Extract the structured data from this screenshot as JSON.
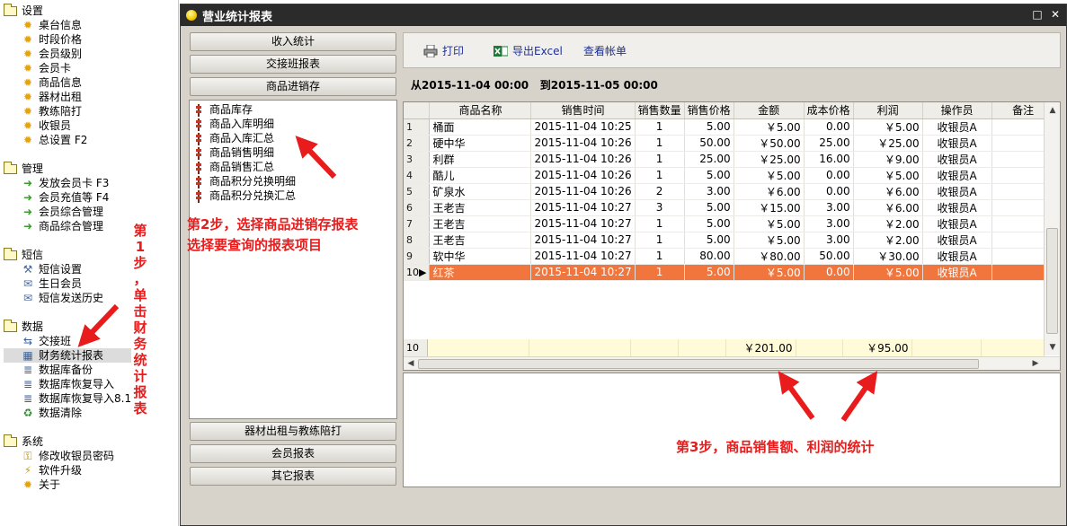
{
  "tree": {
    "groups": [
      {
        "label": "设置",
        "items": [
          "桌台信息",
          "时段价格",
          "会员级别",
          "会员卡",
          "商品信息",
          "器材出租",
          "教练陪打",
          "收银员",
          "总设置 F2"
        ]
      },
      {
        "label": "管理",
        "items": [
          "发放会员卡 F3",
          "会员充值等 F4",
          "会员综合管理",
          "商品综合管理"
        ]
      },
      {
        "label": "短信",
        "items": [
          "短信设置",
          "生日会员",
          "短信发送历史"
        ]
      },
      {
        "label": "数据",
        "items": [
          "交接班",
          "财务统计报表",
          "数据库备份",
          "数据库恢复导入",
          "数据库恢复导入8.1",
          "数据清除"
        ]
      },
      {
        "label": "系统",
        "items": [
          "修改收银员密码",
          "软件升级",
          "关于"
        ]
      }
    ]
  },
  "window": {
    "title": "营业统计报表",
    "minimize_glyph": "□",
    "close_glyph": "✕"
  },
  "menu": {
    "top_buttons": [
      "收入统计",
      "交接班报表",
      "商品进销存"
    ],
    "report_items": [
      "商品库存",
      "商品入库明细",
      "商品入库汇总",
      "商品销售明细",
      "商品销售汇总",
      "商品积分兑换明细",
      "商品积分兑换汇总"
    ],
    "bottom_buttons": [
      "器材出租与教练陪打",
      "会员报表",
      "其它报表"
    ]
  },
  "toolbar": {
    "print_label": "打印",
    "export_label": "导出Excel",
    "view_label": "查看帐单"
  },
  "date_range": {
    "from_label": "从",
    "from": "2015-11-04 00:00",
    "to_label": "到",
    "to": "2015-11-05 00:00"
  },
  "grid": {
    "columns": [
      "",
      "商品名称",
      "销售时间",
      "销售数量",
      "销售价格",
      "金额",
      "成本价格",
      "利润",
      "操作员",
      "备注"
    ],
    "rows": [
      [
        "1",
        "桶面",
        "2015-11-04 10:25",
        "1",
        "5.00",
        "￥5.00",
        "0.00",
        "￥5.00",
        "收银员A",
        ""
      ],
      [
        "2",
        "硬中华",
        "2015-11-04 10:26",
        "1",
        "50.00",
        "￥50.00",
        "25.00",
        "￥25.00",
        "收银员A",
        ""
      ],
      [
        "3",
        "利群",
        "2015-11-04 10:26",
        "1",
        "25.00",
        "￥25.00",
        "16.00",
        "￥9.00",
        "收银员A",
        ""
      ],
      [
        "4",
        "酷儿",
        "2015-11-04 10:26",
        "1",
        "5.00",
        "￥5.00",
        "0.00",
        "￥5.00",
        "收银员A",
        ""
      ],
      [
        "5",
        "矿泉水",
        "2015-11-04 10:26",
        "2",
        "3.00",
        "￥6.00",
        "0.00",
        "￥6.00",
        "收银员A",
        ""
      ],
      [
        "6",
        "王老吉",
        "2015-11-04 10:27",
        "3",
        "5.00",
        "￥15.00",
        "3.00",
        "￥6.00",
        "收银员A",
        ""
      ],
      [
        "7",
        "王老吉",
        "2015-11-04 10:27",
        "1",
        "5.00",
        "￥5.00",
        "3.00",
        "￥2.00",
        "收银员A",
        ""
      ],
      [
        "8",
        "王老吉",
        "2015-11-04 10:27",
        "1",
        "5.00",
        "￥5.00",
        "3.00",
        "￥2.00",
        "收银员A",
        ""
      ],
      [
        "9",
        "软中华",
        "2015-11-04 10:27",
        "1",
        "80.00",
        "￥80.00",
        "50.00",
        "￥30.00",
        "收银员A",
        ""
      ],
      [
        "10",
        "红茶",
        "2015-11-04 10:27",
        "1",
        "5.00",
        "￥5.00",
        "0.00",
        "￥5.00",
        "收银员A",
        ""
      ]
    ],
    "selected_row_index": 9,
    "totals": {
      "count": "10",
      "amount": "￥201.00",
      "profit": "￥95.00"
    }
  },
  "annotations": {
    "step1": "第1步，单击财务统计报表",
    "step2_line1": "第2步，选择商品进销存报表",
    "step2_line2": "选择要查询的报表项目",
    "step3": "第3步，商品销售额、利润的统计"
  },
  "colors": {
    "annotation": "#e81c1c",
    "selected_row": "#f0763e",
    "title_bar": "#2b2b2b"
  }
}
